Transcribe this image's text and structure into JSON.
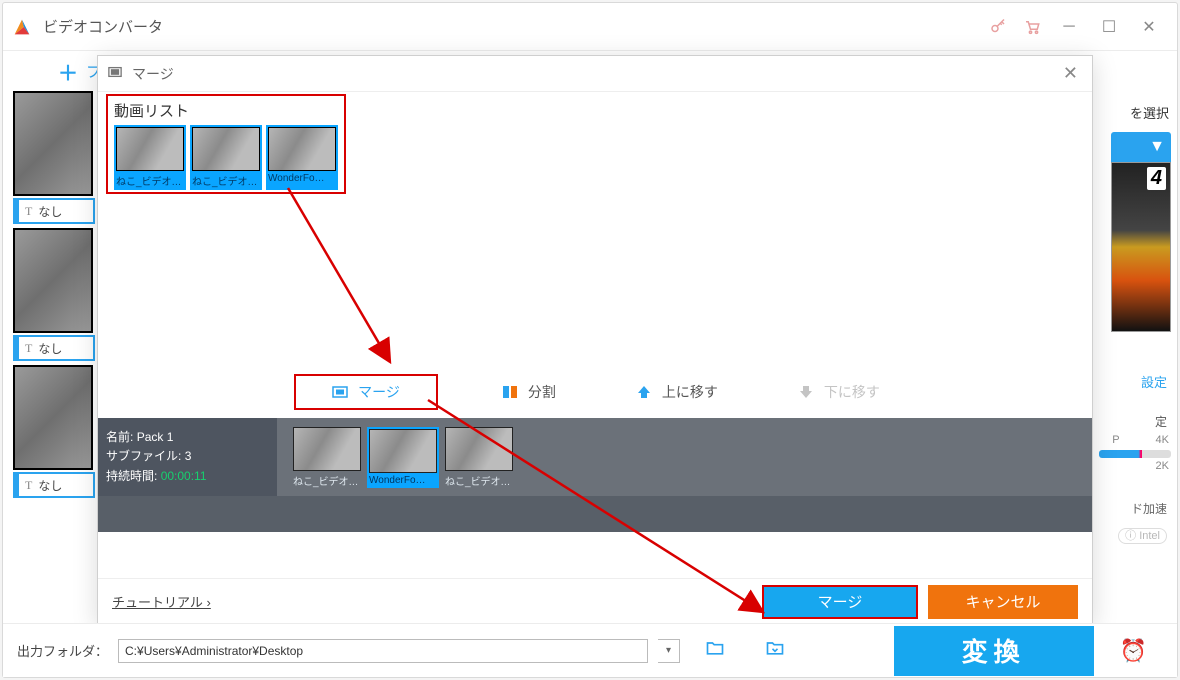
{
  "app": {
    "title": "ビデオコンバータ"
  },
  "secbar": {
    "add_label": "フ"
  },
  "left_clips": {
    "tag_label": "なし"
  },
  "right": {
    "select_label": "を選択",
    "four": "4",
    "settings": "設定",
    "small1": "定",
    "q_left": "P",
    "q_right": "4K",
    "q_2k": "2K",
    "accel": "ド加速",
    "intel": "Intel"
  },
  "modal": {
    "title": "マージ",
    "list_title": "動画リスト",
    "thumbs": [
      {
        "cap": "ねこ_ビデオク…"
      },
      {
        "cap": "ねこ_ビデオク…"
      },
      {
        "cap": "WonderFo…"
      }
    ],
    "tools": {
      "merge": "マージ",
      "split": "分割",
      "moveup": "上に移す",
      "movedown": "下に移す"
    },
    "pack": {
      "name_label": "名前:",
      "name_value": "Pack 1",
      "sub_label": "サブファイル:",
      "sub_value": "3",
      "dur_label": "持続時間:",
      "dur_value": "00:00:11",
      "thumbs": [
        {
          "cap": "ねこ_ビデオク…",
          "sel": false
        },
        {
          "cap": "WonderFo…",
          "sel": true
        },
        {
          "cap": "ねこ_ビデオク…",
          "sel": false
        }
      ]
    },
    "tutorial": "チュートリアル ›",
    "merge_btn": "マージ",
    "cancel_btn": "キャンセル"
  },
  "bottom": {
    "out_label": "出力フォルダ：",
    "out_path": "C:¥Users¥Administrator¥Desktop",
    "convert": "変換"
  }
}
